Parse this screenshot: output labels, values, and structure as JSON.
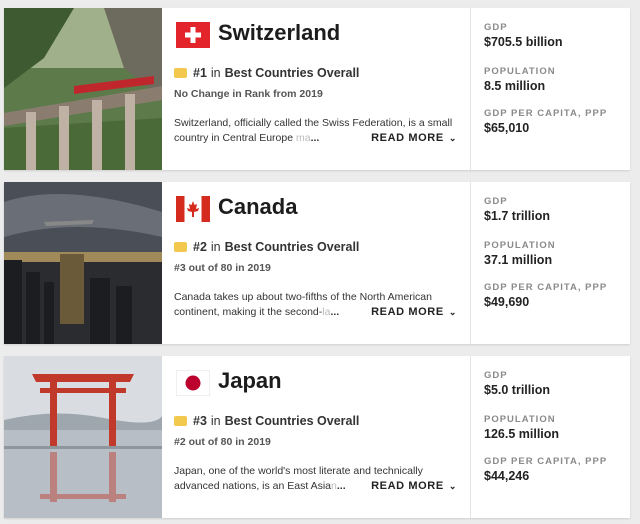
{
  "countries": [
    {
      "name": "Switzerland",
      "flag_icon": "swiss-flag-icon",
      "rank": "#1",
      "rank_in": "in",
      "rank_category": "Best Countries Overall",
      "rank_change": "No Change in Rank from 2019",
      "description": "Switzerland, officially called the Swiss Federation, is a small country in Central Europe ",
      "description_fade": "ma",
      "ellipsis": "...",
      "read_more": "READ MORE",
      "gdp_label": "GDP",
      "gdp": "$705.5 billion",
      "population_label": "POPULATION",
      "population": "8.5 million",
      "gdp_pc_label": "GDP PER CAPITA, PPP",
      "gdp_pc": "$65,010"
    },
    {
      "name": "Canada",
      "flag_icon": "canada-flag-icon",
      "rank": "#2",
      "rank_in": "in",
      "rank_category": "Best Countries Overall",
      "rank_change": "#3 out of 80 in 2019",
      "description": "Canada takes up about two-fifths of the North American continent, making it the second-",
      "description_fade": "la",
      "ellipsis": "...",
      "read_more": "READ MORE",
      "gdp_label": "GDP",
      "gdp": "$1.7 trillion",
      "population_label": "POPULATION",
      "population": "37.1 million",
      "gdp_pc_label": "GDP PER CAPITA, PPP",
      "gdp_pc": "$49,690"
    },
    {
      "name": "Japan",
      "flag_icon": "japan-flag-icon",
      "rank": "#3",
      "rank_in": "in",
      "rank_category": "Best Countries Overall",
      "rank_change": "#2 out of 80 in 2019",
      "description": "Japan, one of the world's most literate and technically advanced nations, is an East Asia",
      "description_fade": "n",
      "ellipsis": "...",
      "read_more": "READ MORE",
      "gdp_label": "GDP",
      "gdp": "$5.0 trillion",
      "population_label": "POPULATION",
      "population": "126.5 million",
      "gdp_pc_label": "GDP PER CAPITA, PPP",
      "gdp_pc": "$44,246"
    }
  ],
  "colors": {
    "swiss_red": "#e3242b",
    "canada_red": "#d52b1e",
    "japan_red": "#bc002d",
    "medal": "#f2c94c"
  }
}
